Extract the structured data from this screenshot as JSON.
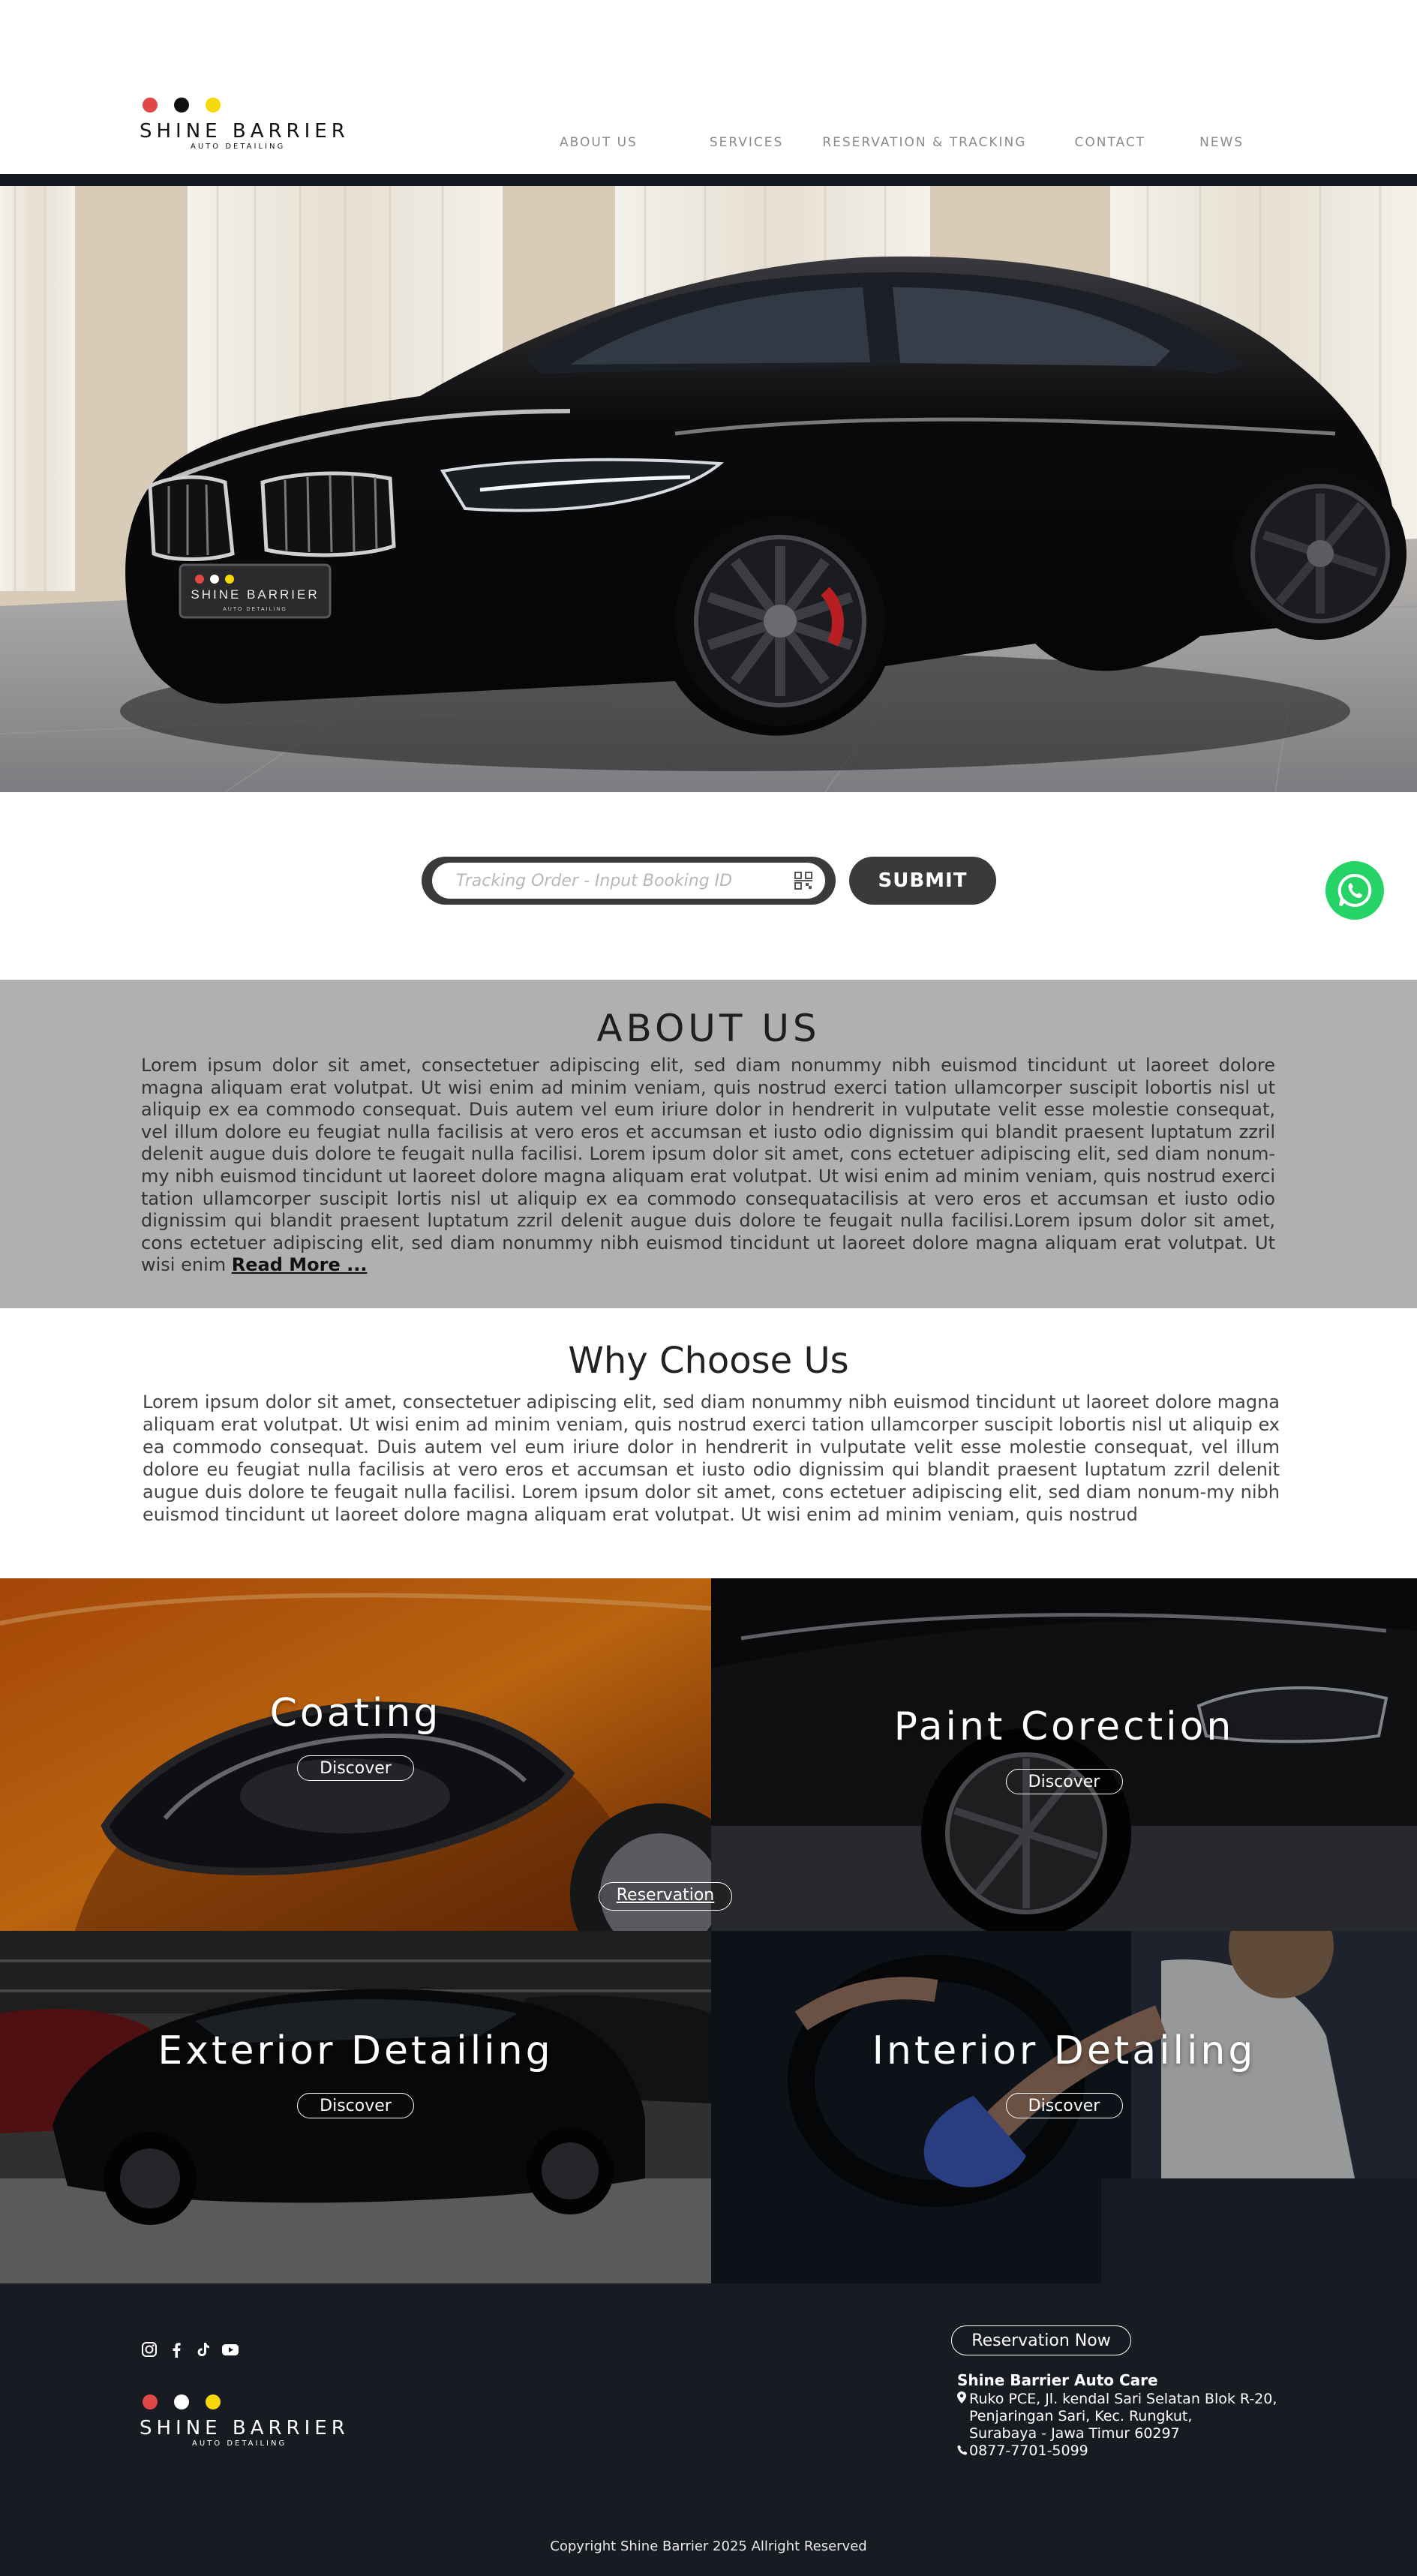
{
  "brand": {
    "name": "SHINE BARRIER",
    "tagline": "AUTO DETAILING",
    "dot_colors": [
      "#e04848",
      "#111111",
      "#f5d90a"
    ]
  },
  "nav": {
    "items": [
      {
        "label": "ABOUT US"
      },
      {
        "label": "SERVICES"
      },
      {
        "label": "RESERVATION & TRACKING"
      },
      {
        "label": "CONTACT"
      },
      {
        "label": "NEWS"
      }
    ]
  },
  "hero": {
    "image_name": "black-sports-car-showroom",
    "plate_brand": "SHINE BARRIER",
    "plate_tagline": "AUTO DETAILING"
  },
  "tracking": {
    "placeholder": "Tracking Order - Input Booking ID",
    "submit_label": "SUBMIT",
    "scan_icon": "qr-scan-icon"
  },
  "whatsapp": {
    "icon": "whatsapp-icon",
    "color": "#25d366"
  },
  "about": {
    "title": "ABOUT US",
    "body": "Lorem ipsum dolor sit amet, consectetuer adipiscing elit, sed diam nonummy nibh euismod tincidunt ut laoreet dolore magna aliquam erat volutpat. Ut wisi enim ad minim veniam, quis nostrud exerci tation ullamcorper suscipit lobortis nisl ut aliquip ex ea commodo consequat. Duis autem vel eum iriure dolor in hendrerit in vulputate velit esse molestie consequat, vel illum dolore eu feugiat nulla facilisis at vero eros et accumsan et iusto odio dignissim qui blandit praesent luptatum zzril delenit augue duis dolore te feugait nulla facilisi. Lorem ipsum dolor sit amet, cons ectetuer adipiscing elit, sed diam nonum-my nibh euismod tincidunt ut laoreet dolore magna aliquam erat volutpat. Ut wisi enim ad minim veniam, quis nostrud exerci tation ullamcorper suscipit lortis nisl ut aliquip ex ea commodo consequatacilisis at vero eros et accumsan et iusto odio dignissim qui blandit praesent luptatum zzril delenit augue duis dolore te feugait nulla facilisi.Lorem ipsum dolor sit amet, cons ectetuer adipiscing elit, sed diam nonummy nibh euismod tincidunt ut laoreet dolore magna aliquam erat volutpat. Ut wisi enim ",
    "read_more": "Read More ..."
  },
  "why": {
    "title": "Why Choose Us",
    "body": "Lorem ipsum dolor sit amet, consectetuer adipiscing elit, sed diam nonummy nibh euismod tincidunt ut laoreet dolore magna aliquam erat volutpat. Ut wisi enim ad minim veniam, quis nostrud exerci tation ullamcorper suscipit lobortis nisl ut aliquip ex ea commodo consequat. Duis autem vel eum iriure dolor in hendrerit in vulputate velit esse molestie consequat, vel illum dolore eu feugiat nulla facilisis at vero eros et accumsan et iusto odio dignissim qui blandit praesent luptatum zzril delenit augue duis dolore te feugait nulla facilisi. Lorem ipsum dolor sit amet, cons ectetuer adipiscing elit, sed diam nonum-my nibh euismod tincidunt ut laoreet dolore magna aliquam erat volutpat. Ut wisi enim ad minim veniam, quis nostrud"
  },
  "services": {
    "discover_label": "Discover",
    "reservation_label": "Reservation",
    "items": [
      {
        "title": "Coating",
        "image": "orange-car-headlight"
      },
      {
        "title": "Paint Corection",
        "image": "black-car-wheel"
      },
      {
        "title": "Exterior Detailing",
        "image": "black-sedan-garage"
      },
      {
        "title": "Interior Detailing",
        "image": "man-cleaning-steering-wheel"
      }
    ]
  },
  "footer": {
    "socials": [
      "instagram-icon",
      "facebook-icon",
      "tiktok-icon",
      "youtube-icon"
    ],
    "dot_colors": [
      "#e04848",
      "#ffffff",
      "#f5d90a"
    ],
    "reservation_button": "Reservation Now",
    "company_name": "Shine Barrier Auto Care",
    "address_line1": "Ruko PCE, Jl. kendal Sari Selatan Blok R-20,",
    "address_line2": "Penjaringan Sari, Kec. Rungkut,",
    "address_line3": "Surabaya - Jawa Timur 60297",
    "phone": "0877-7701-5099",
    "copyright": "Copyright Shine Barrier 2025 Allright Reserved"
  }
}
